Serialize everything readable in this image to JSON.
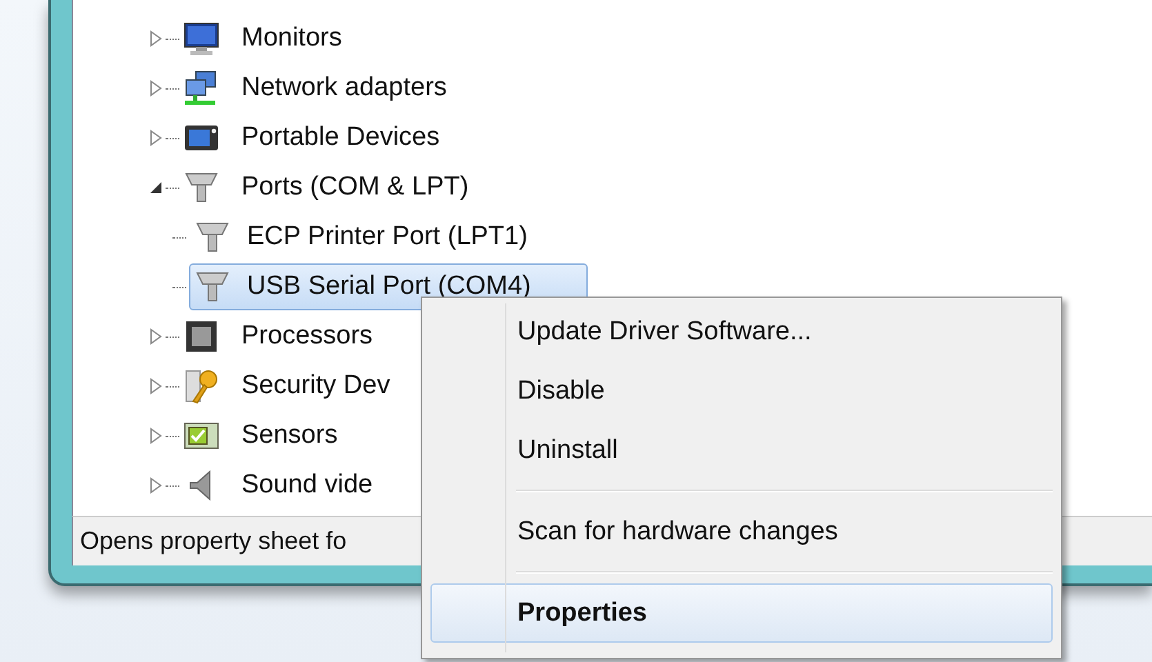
{
  "tree": {
    "items": [
      {
        "label": "Monitors",
        "expanded": false,
        "selected": false
      },
      {
        "label": "Network adapters",
        "expanded": false,
        "selected": false
      },
      {
        "label": "Portable Devices",
        "expanded": false,
        "selected": false
      },
      {
        "label": "Ports (COM & LPT)",
        "expanded": true,
        "selected": false,
        "children": [
          {
            "label": "ECP Printer Port (LPT1)",
            "selected": false
          },
          {
            "label": "USB Serial Port (COM4)",
            "selected": true
          }
        ]
      },
      {
        "label": "Processors",
        "expanded": false,
        "selected": false
      },
      {
        "label": "Security Dev",
        "expanded": false,
        "selected": false
      },
      {
        "label": "Sensors",
        "expanded": false,
        "selected": false
      },
      {
        "label": "Sound vide",
        "expanded": false,
        "selected": false
      }
    ]
  },
  "status_bar": {
    "text": "Opens property sheet fo"
  },
  "context_menu": {
    "items": [
      {
        "kind": "item",
        "label": "Update Driver Software...",
        "bold": false,
        "highlighted": false
      },
      {
        "kind": "item",
        "label": "Disable",
        "bold": false,
        "highlighted": false
      },
      {
        "kind": "item",
        "label": "Uninstall",
        "bold": false,
        "highlighted": false
      },
      {
        "kind": "separator"
      },
      {
        "kind": "item",
        "label": "Scan for hardware changes",
        "bold": false,
        "highlighted": false
      },
      {
        "kind": "separator"
      },
      {
        "kind": "item",
        "label": "Properties",
        "bold": true,
        "highlighted": true
      }
    ]
  }
}
